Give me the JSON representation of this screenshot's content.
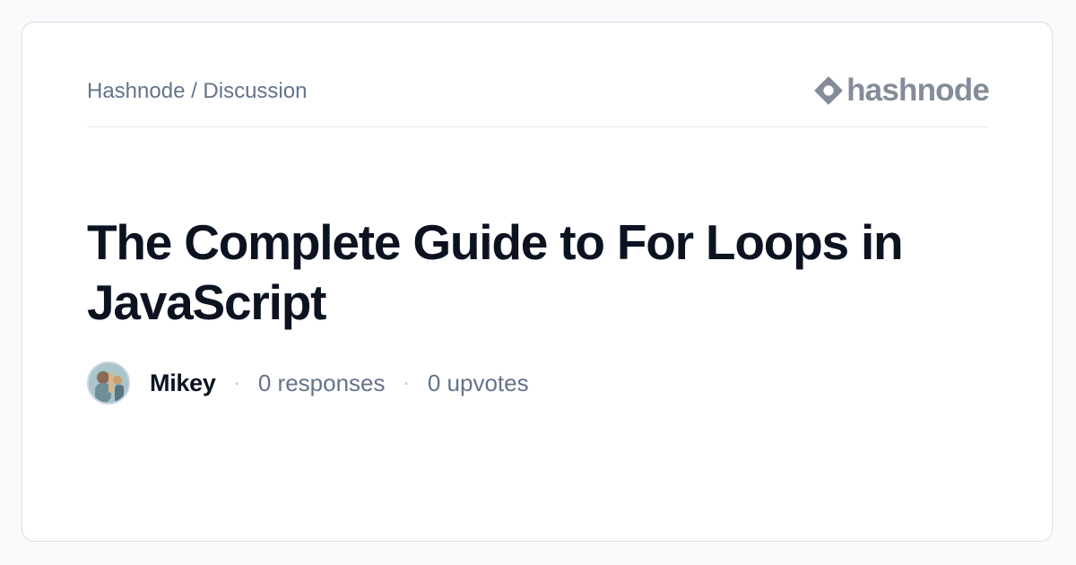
{
  "header": {
    "breadcrumb": "Hashnode / Discussion",
    "brand_name": "hashnode"
  },
  "post": {
    "title": "The Complete Guide to For Loops in JavaScript"
  },
  "meta": {
    "author": "Mikey",
    "separator": "·",
    "responses": "0 responses",
    "upvotes": "0 upvotes"
  },
  "icons": {
    "brand": "hashnode-logo-icon",
    "avatar": "author-avatar"
  },
  "colors": {
    "background": "#f8fafc",
    "card": "#ffffff",
    "title": "#0b1220",
    "muted": "#64748b",
    "brand": "#848c99"
  }
}
